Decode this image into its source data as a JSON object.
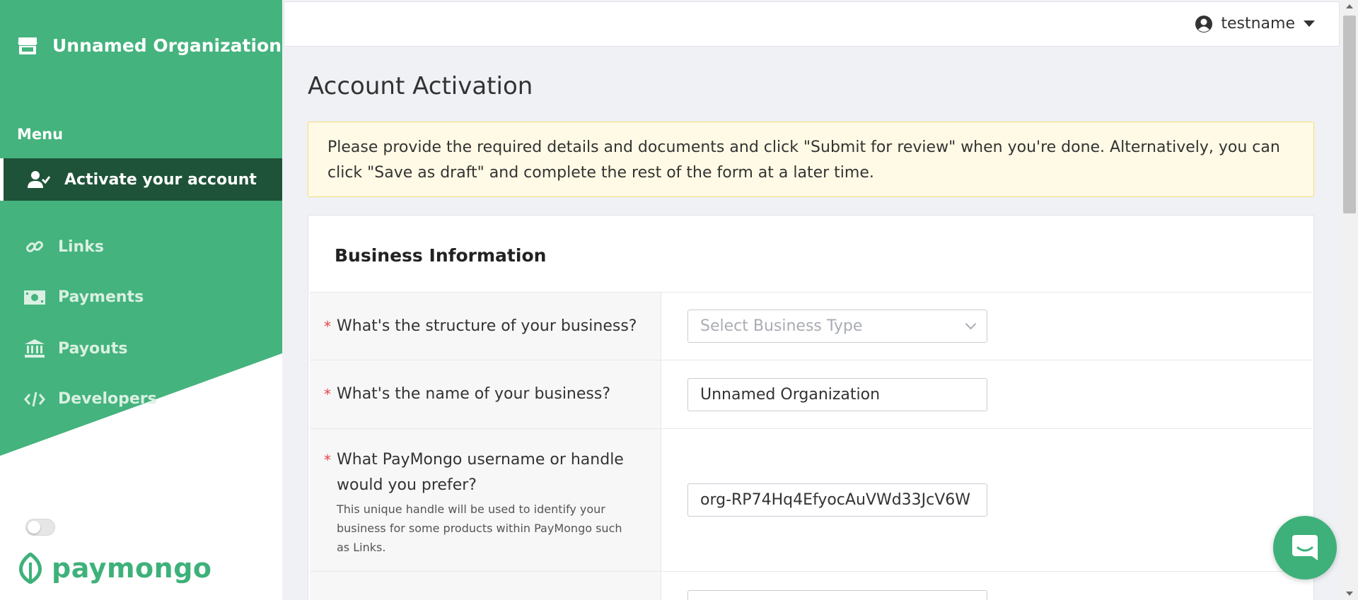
{
  "sidebar": {
    "org_name": "Unnamed Organization",
    "menu_label": "Menu",
    "active_item": {
      "label": "Activate your account",
      "icon": "user-check-icon"
    },
    "items": [
      {
        "label": "Links",
        "icon": "link-icon"
      },
      {
        "label": "Payments",
        "icon": "money-bill-icon"
      },
      {
        "label": "Payouts",
        "icon": "bank-icon"
      },
      {
        "label": "Developers",
        "icon": "code-icon"
      }
    ],
    "logo_text": "paymongo"
  },
  "topbar": {
    "username": "testname"
  },
  "page": {
    "title": "Account Activation",
    "alert": "Please provide the required details and documents and click \"Submit for review\" when you're done. Alternatively, you can click \"Save as draft\" and complete the rest of the form at a later time."
  },
  "card": {
    "title": "Business Information",
    "rows": [
      {
        "question": "What's the structure of your business?",
        "placeholder": "Select Business Type"
      },
      {
        "question": "What's the name of your business?",
        "value": "Unnamed Organization"
      },
      {
        "question": "What PayMongo username or handle would you prefer?",
        "help": "This unique handle will be used to identify your business for some products within PayMongo such as Links.",
        "value": "org-RP74Hq4EfyocAuVWd33JcV6W"
      }
    ]
  },
  "colors": {
    "brand_green": "#3eb17a",
    "active_nav": "#1e5339",
    "alert_bg": "#fffae5",
    "required": "#e54545"
  }
}
